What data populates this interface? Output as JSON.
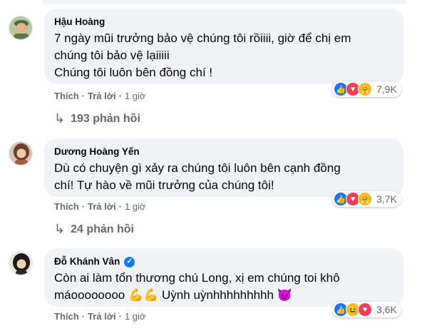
{
  "comments": [
    {
      "author": "Hậu Hoàng",
      "text_lines": [
        "7 ngày mũi trưởng bảo vệ chúng tôi rồiiii, giờ để chị em",
        "chúng tôi bảo vệ lạiiiii",
        "Chúng tôi luôn bên đồng chí !"
      ],
      "like_label": "Thích",
      "reply_label": "Trả lời",
      "time": "1 giờ",
      "reaction_count": "7,9K",
      "reaction_icons": [
        "like-icon",
        "love-icon",
        "care-icon"
      ],
      "replies_label": "193 phản hồi"
    },
    {
      "author": "Dương Hoàng Yến",
      "text_lines": [
        "Dù có chuyện gì xảy ra chúng tôi luôn bên cạnh đồng",
        "chí! Tự hào về mũi trưởng của chúng tôi!"
      ],
      "like_label": "Thích",
      "reply_label": "Trả lời",
      "time": "1 giờ",
      "reaction_count": "3,7K",
      "reaction_icons": [
        "like-icon",
        "love-icon",
        "care-icon"
      ],
      "replies_label": "24 phản hồi"
    },
    {
      "author": "Đỗ Khánh Vân",
      "verified": true,
      "text_lines": [
        "Còn ai làm tổn thương chú Long, xị em chúng toi khô",
        "máoooooooo 💪💪 Uỳnh uỳnhhhhhhhhh 😈"
      ],
      "like_label": "Thích",
      "reply_label": "Trả lời",
      "time": "1 giờ",
      "reaction_count": "3,6K",
      "reaction_icons": [
        "like-icon",
        "haha-icon",
        "love-icon"
      ]
    }
  ],
  "colors": {
    "bubble": "#f0f2f5",
    "meta": "#65676b",
    "like": "#1877f2",
    "love": "#f33e58",
    "care": "#f7b928"
  }
}
